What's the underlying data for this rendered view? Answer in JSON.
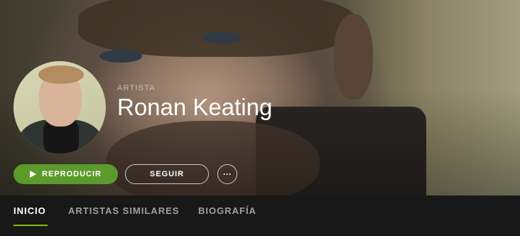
{
  "artist": {
    "type_label": "ARTISTA",
    "name": "Ronan Keating"
  },
  "actions": {
    "play_label": "REPRODUCIR",
    "follow_label": "SEGUIR",
    "more_label": "···"
  },
  "tabs": [
    {
      "label": "INICIO",
      "active": true
    },
    {
      "label": "ARTISTAS SIMILARES",
      "active": false
    },
    {
      "label": "BIOGRAFÍA",
      "active": false
    }
  ],
  "colors": {
    "accent": "#84bd00",
    "play_button": "#5c9a2c",
    "tab_bar": "#181818"
  }
}
